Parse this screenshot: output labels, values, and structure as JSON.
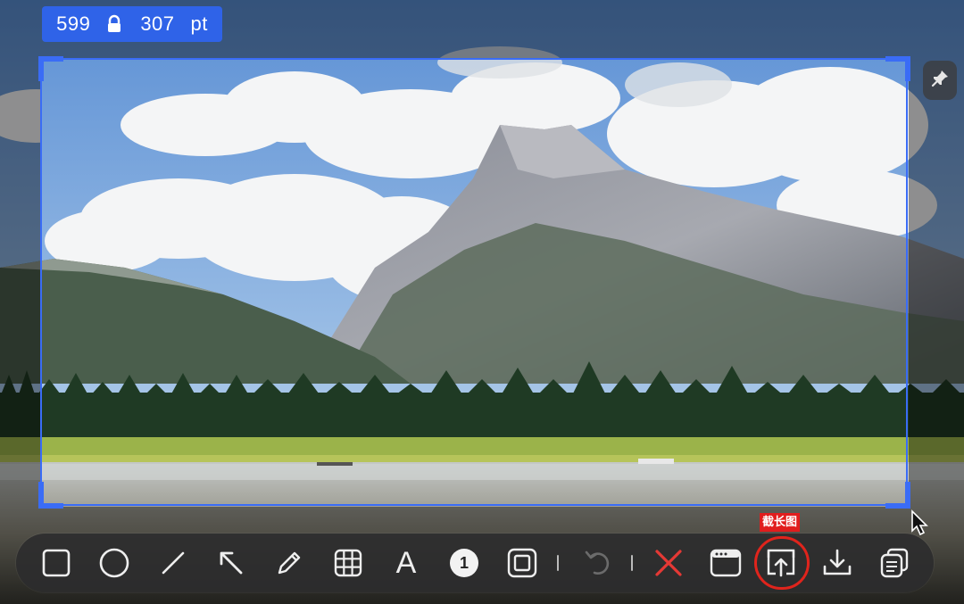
{
  "selection": {
    "width": "599",
    "height": "307",
    "unit": "pt"
  },
  "tooltip": {
    "long_screenshot_label": "截长图"
  },
  "toolbar": {
    "tools": [
      {
        "name": "rectangle-tool",
        "icon": "square-icon"
      },
      {
        "name": "ellipse-tool",
        "icon": "circle-icon"
      },
      {
        "name": "line-tool",
        "icon": "line-icon"
      },
      {
        "name": "arrow-tool",
        "icon": "arrow-icon"
      },
      {
        "name": "pencil-tool",
        "icon": "pencil-icon"
      },
      {
        "name": "mosaic-tool",
        "icon": "grid-icon"
      },
      {
        "name": "text-tool",
        "icon": "text-icon",
        "glyph": "A"
      },
      {
        "name": "number-tool",
        "icon": "number-badge-icon",
        "glyph": "1"
      },
      {
        "name": "highlight-tool",
        "icon": "framed-square-icon"
      },
      {
        "name": "undo-button",
        "icon": "undo-icon",
        "disabled": true
      },
      {
        "name": "cancel-button",
        "icon": "close-icon"
      },
      {
        "name": "window-capture-button",
        "icon": "window-icon"
      },
      {
        "name": "long-screenshot-button",
        "icon": "upload-icon",
        "highlighted": true
      },
      {
        "name": "download-button",
        "icon": "download-icon"
      },
      {
        "name": "copy-button",
        "icon": "copy-icon"
      }
    ]
  },
  "colors": {
    "accent": "#3a6cf6",
    "cancel": "#e53935",
    "highlight_ring": "#e0241c",
    "toolbar_bg": "#2c2c2e"
  }
}
